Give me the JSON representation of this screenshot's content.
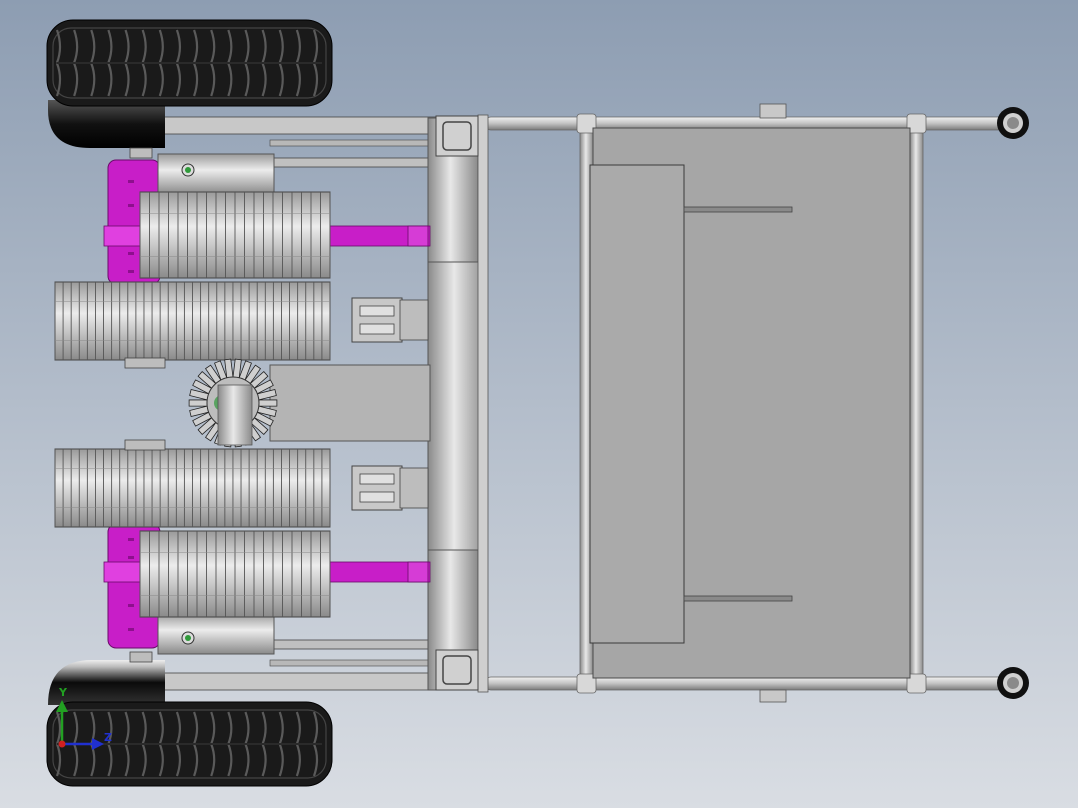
{
  "view": {
    "background_top": "#8d9db2",
    "background_bottom": "#d9dde3"
  },
  "colors": {
    "tire": "#1a1a1a",
    "tire_tread": "#3a3a3a",
    "metal": "#c4c4c4",
    "metal_dark": "#8f8f8f",
    "metal_light": "#e6e6e6",
    "plate": "#a9a9a9",
    "magenta": "#c81ec8",
    "magenta_dark": "#8e0f8e",
    "green_dot": "#2f9a3a",
    "outline": "#3a3a3a"
  },
  "triad": {
    "y_label": "Y",
    "x_label": "Z",
    "y_color": "#22a022",
    "x_color": "#2030d0",
    "origin_color": "#d02020"
  },
  "icons": [
    "axis-triad-icon"
  ]
}
